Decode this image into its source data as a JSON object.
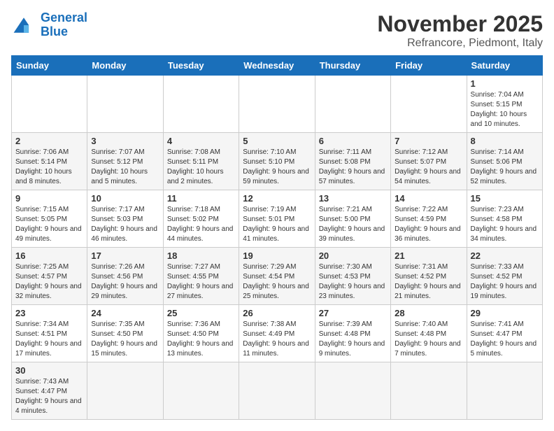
{
  "logo": {
    "text_general": "General",
    "text_blue": "Blue"
  },
  "title": "November 2025",
  "subtitle": "Refrancore, Piedmont, Italy",
  "days_of_week": [
    "Sunday",
    "Monday",
    "Tuesday",
    "Wednesday",
    "Thursday",
    "Friday",
    "Saturday"
  ],
  "weeks": [
    [
      {
        "day": "",
        "info": ""
      },
      {
        "day": "",
        "info": ""
      },
      {
        "day": "",
        "info": ""
      },
      {
        "day": "",
        "info": ""
      },
      {
        "day": "",
        "info": ""
      },
      {
        "day": "",
        "info": ""
      },
      {
        "day": "1",
        "info": "Sunrise: 7:04 AM\nSunset: 5:15 PM\nDaylight: 10 hours and 10 minutes."
      }
    ],
    [
      {
        "day": "2",
        "info": "Sunrise: 7:06 AM\nSunset: 5:14 PM\nDaylight: 10 hours and 8 minutes."
      },
      {
        "day": "3",
        "info": "Sunrise: 7:07 AM\nSunset: 5:12 PM\nDaylight: 10 hours and 5 minutes."
      },
      {
        "day": "4",
        "info": "Sunrise: 7:08 AM\nSunset: 5:11 PM\nDaylight: 10 hours and 2 minutes."
      },
      {
        "day": "5",
        "info": "Sunrise: 7:10 AM\nSunset: 5:10 PM\nDaylight: 9 hours and 59 minutes."
      },
      {
        "day": "6",
        "info": "Sunrise: 7:11 AM\nSunset: 5:08 PM\nDaylight: 9 hours and 57 minutes."
      },
      {
        "day": "7",
        "info": "Sunrise: 7:12 AM\nSunset: 5:07 PM\nDaylight: 9 hours and 54 minutes."
      },
      {
        "day": "8",
        "info": "Sunrise: 7:14 AM\nSunset: 5:06 PM\nDaylight: 9 hours and 52 minutes."
      }
    ],
    [
      {
        "day": "9",
        "info": "Sunrise: 7:15 AM\nSunset: 5:05 PM\nDaylight: 9 hours and 49 minutes."
      },
      {
        "day": "10",
        "info": "Sunrise: 7:17 AM\nSunset: 5:03 PM\nDaylight: 9 hours and 46 minutes."
      },
      {
        "day": "11",
        "info": "Sunrise: 7:18 AM\nSunset: 5:02 PM\nDaylight: 9 hours and 44 minutes."
      },
      {
        "day": "12",
        "info": "Sunrise: 7:19 AM\nSunset: 5:01 PM\nDaylight: 9 hours and 41 minutes."
      },
      {
        "day": "13",
        "info": "Sunrise: 7:21 AM\nSunset: 5:00 PM\nDaylight: 9 hours and 39 minutes."
      },
      {
        "day": "14",
        "info": "Sunrise: 7:22 AM\nSunset: 4:59 PM\nDaylight: 9 hours and 36 minutes."
      },
      {
        "day": "15",
        "info": "Sunrise: 7:23 AM\nSunset: 4:58 PM\nDaylight: 9 hours and 34 minutes."
      }
    ],
    [
      {
        "day": "16",
        "info": "Sunrise: 7:25 AM\nSunset: 4:57 PM\nDaylight: 9 hours and 32 minutes."
      },
      {
        "day": "17",
        "info": "Sunrise: 7:26 AM\nSunset: 4:56 PM\nDaylight: 9 hours and 29 minutes."
      },
      {
        "day": "18",
        "info": "Sunrise: 7:27 AM\nSunset: 4:55 PM\nDaylight: 9 hours and 27 minutes."
      },
      {
        "day": "19",
        "info": "Sunrise: 7:29 AM\nSunset: 4:54 PM\nDaylight: 9 hours and 25 minutes."
      },
      {
        "day": "20",
        "info": "Sunrise: 7:30 AM\nSunset: 4:53 PM\nDaylight: 9 hours and 23 minutes."
      },
      {
        "day": "21",
        "info": "Sunrise: 7:31 AM\nSunset: 4:52 PM\nDaylight: 9 hours and 21 minutes."
      },
      {
        "day": "22",
        "info": "Sunrise: 7:33 AM\nSunset: 4:52 PM\nDaylight: 9 hours and 19 minutes."
      }
    ],
    [
      {
        "day": "23",
        "info": "Sunrise: 7:34 AM\nSunset: 4:51 PM\nDaylight: 9 hours and 17 minutes."
      },
      {
        "day": "24",
        "info": "Sunrise: 7:35 AM\nSunset: 4:50 PM\nDaylight: 9 hours and 15 minutes."
      },
      {
        "day": "25",
        "info": "Sunrise: 7:36 AM\nSunset: 4:50 PM\nDaylight: 9 hours and 13 minutes."
      },
      {
        "day": "26",
        "info": "Sunrise: 7:38 AM\nSunset: 4:49 PM\nDaylight: 9 hours and 11 minutes."
      },
      {
        "day": "27",
        "info": "Sunrise: 7:39 AM\nSunset: 4:48 PM\nDaylight: 9 hours and 9 minutes."
      },
      {
        "day": "28",
        "info": "Sunrise: 7:40 AM\nSunset: 4:48 PM\nDaylight: 9 hours and 7 minutes."
      },
      {
        "day": "29",
        "info": "Sunrise: 7:41 AM\nSunset: 4:47 PM\nDaylight: 9 hours and 5 minutes."
      }
    ],
    [
      {
        "day": "30",
        "info": "Sunrise: 7:43 AM\nSunset: 4:47 PM\nDaylight: 9 hours and 4 minutes."
      },
      {
        "day": "",
        "info": ""
      },
      {
        "day": "",
        "info": ""
      },
      {
        "day": "",
        "info": ""
      },
      {
        "day": "",
        "info": ""
      },
      {
        "day": "",
        "info": ""
      },
      {
        "day": "",
        "info": ""
      }
    ]
  ]
}
